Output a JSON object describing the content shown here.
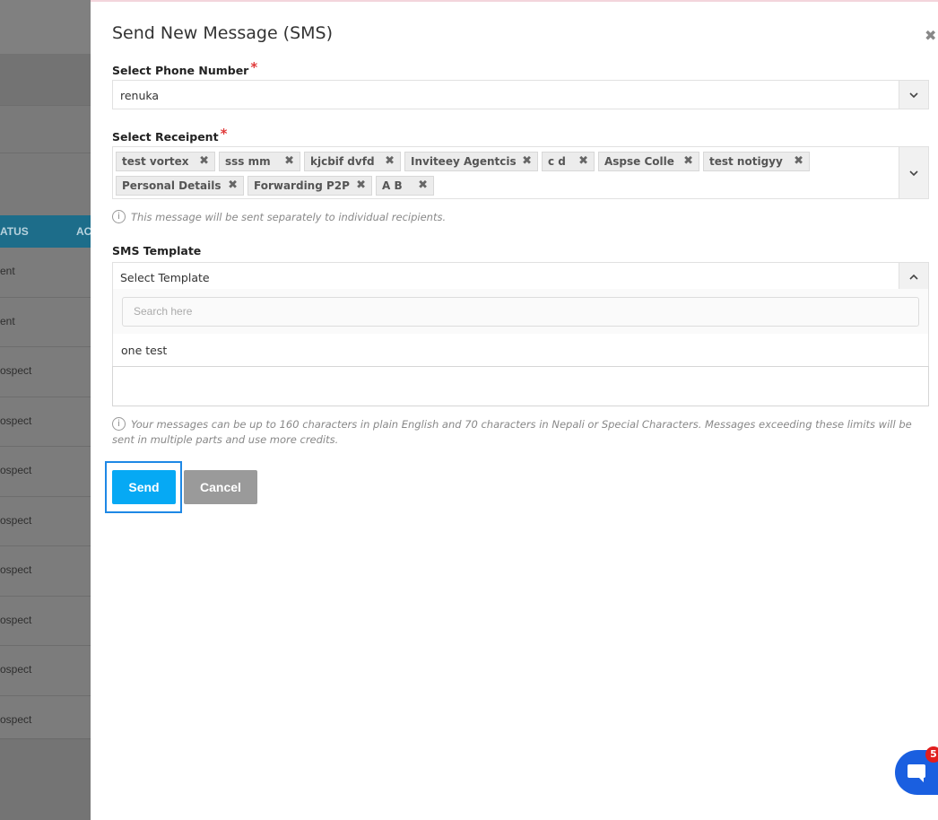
{
  "background": {
    "table_header": {
      "status_label": "ATUS",
      "action_label": "AC"
    },
    "rows": [
      "ent",
      "ent",
      "ospect",
      "ospect",
      "ospect",
      "ospect",
      "ospect",
      "ospect",
      "ospect",
      "ospect"
    ]
  },
  "modal": {
    "title": "Send New Message (SMS)",
    "close_icon": "close-icon",
    "phone": {
      "label": "Select Phone Number",
      "required_mark": "*",
      "value": "renuka"
    },
    "recipient": {
      "label": "Select Receipent",
      "required_mark": "*",
      "tags": [
        "test vortex",
        "sss mm",
        "kjcbif dvfd",
        "Inviteey Agentcis",
        "c d",
        "Aspse Colle",
        "test notigyy",
        "Personal Details",
        "Forwarding P2P",
        "A B"
      ],
      "tag_remove_glyph": "✖",
      "info": "This message will be sent separately to individual recipients."
    },
    "template": {
      "label": "SMS Template",
      "value": "Select Template",
      "search_placeholder": "Search here",
      "options": [
        "one test"
      ]
    },
    "sms_info": "Your messages can be up to 160 characters in plain English and 70 characters in Nepali or Special Characters. Messages exceeding these limits will be sent in multiple parts and use more credits.",
    "buttons": {
      "send": "Send",
      "cancel": "Cancel"
    }
  },
  "chat_widget": {
    "badge_count": "5",
    "icon": "chat-icon"
  },
  "colors": {
    "primary": "#06a9f4",
    "cancel": "#9a9a9a",
    "required": "#e03a3a",
    "chat": "#1a5fe0",
    "badge": "#e11d1d"
  }
}
